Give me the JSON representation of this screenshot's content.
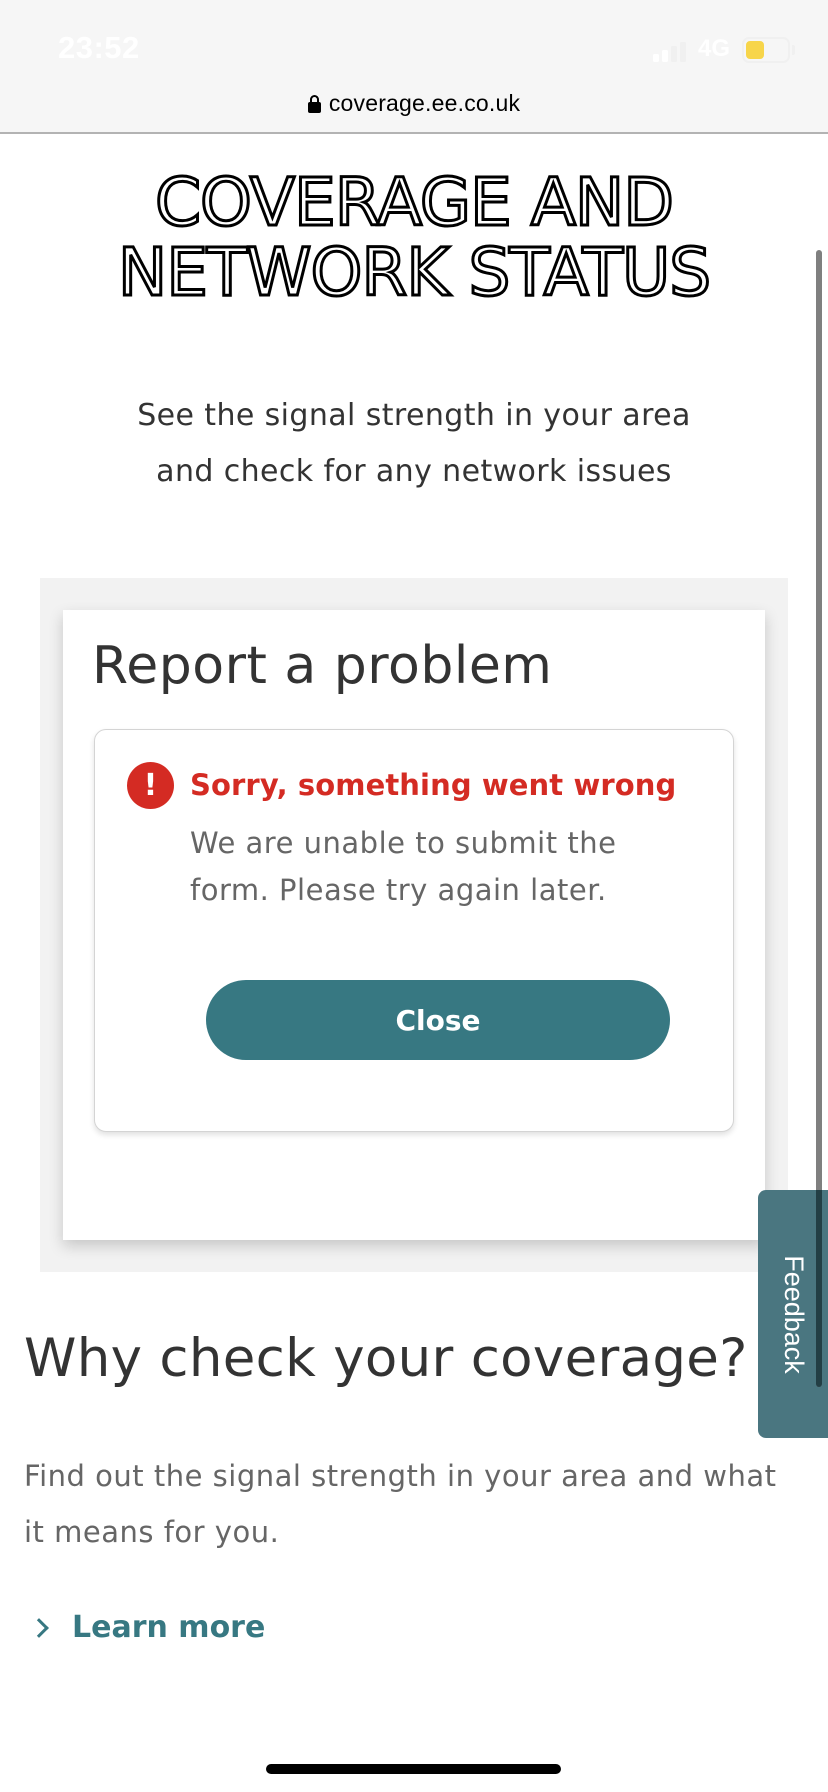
{
  "status_bar": {
    "time": "23:52",
    "network": "4G",
    "signal_bars_filled": 2,
    "signal_bars_total": 4,
    "battery_level_percent": 45,
    "battery_color": "#f7d54a"
  },
  "browser": {
    "url": "coverage.ee.co.uk",
    "secure_icon": "lock-icon"
  },
  "hero": {
    "title_line1": "COVERAGE AND",
    "title_line2": "NETWORK STATUS",
    "subtitle_line1": "See the signal strength in your area",
    "subtitle_line2": "and check for any network issues"
  },
  "modal": {
    "title": "Report a problem",
    "error": {
      "icon": "exclamation-circle-icon",
      "icon_glyph": "!",
      "title": "Sorry, something went wrong",
      "message": "We are unable to submit the form. Please try again later."
    },
    "close_label": "Close"
  },
  "feedback_tab": {
    "label": "Feedback"
  },
  "section": {
    "heading": "Why check your coverage?",
    "body": "Find out the signal strength in your area and what it means for you.",
    "link_label": "Learn more",
    "link_icon": "chevron-right-icon"
  },
  "colors": {
    "accent": "#377882",
    "error": "#d42b23",
    "feedback_tab": "#4a7680",
    "text_primary": "#333333",
    "text_secondary": "#666666"
  }
}
